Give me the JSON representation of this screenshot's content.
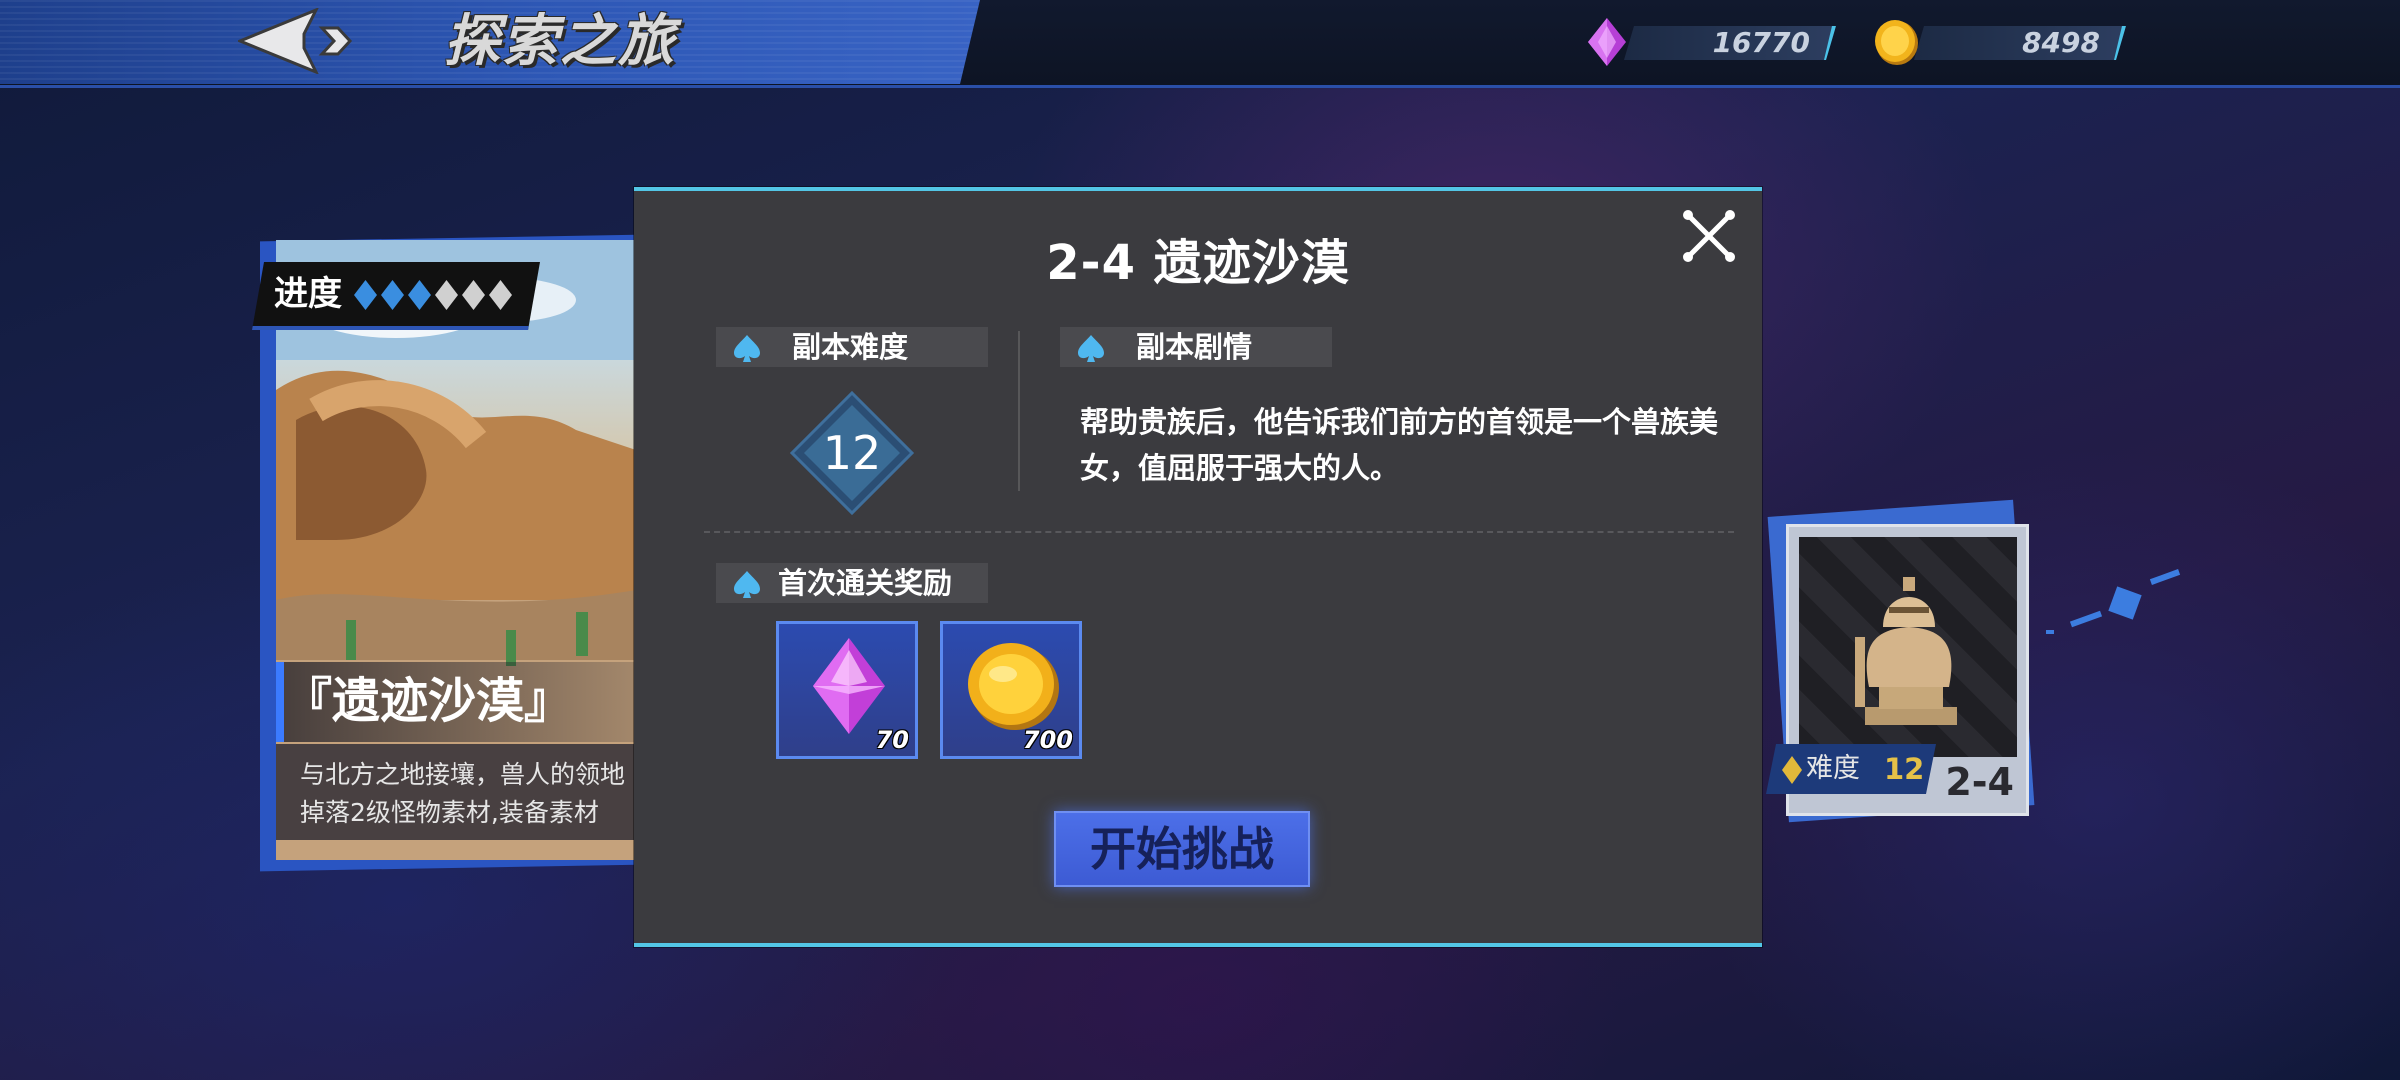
{
  "topbar": {
    "title": "探索之旅",
    "gems": "16770",
    "coins": "8498"
  },
  "stage_card": {
    "progress_label": "进度",
    "progress_total": 6,
    "progress_done": 3,
    "name": "『遗迹沙漠』",
    "desc_line1": "与北方之地接壤，兽人的领地",
    "desc_line2": "掉落2级怪物素材,装备素材"
  },
  "next_card": {
    "difficulty_label": "难度",
    "difficulty_value": "12",
    "stage_label": "2-4"
  },
  "modal": {
    "title": "2-4  遗迹沙漠",
    "difficulty_header": "副本难度",
    "difficulty_value": "12",
    "story_header": "副本剧情",
    "story_text": "帮助贵族后，他告诉我们前方的首领是一个兽族美女，值屈服于强大的人。",
    "reward_header": "首次通关奖励",
    "rewards": [
      {
        "icon": "purple-gem-icon",
        "qty": "70"
      },
      {
        "icon": "gold-coin-icon",
        "qty": "700"
      }
    ],
    "start_button": "开始挑战"
  },
  "colors": {
    "accent_cyan": "#53c6e6",
    "accent_blue": "#3d5bd4",
    "panel_bg": "#3b3b3f",
    "gold": "#e5c148"
  }
}
